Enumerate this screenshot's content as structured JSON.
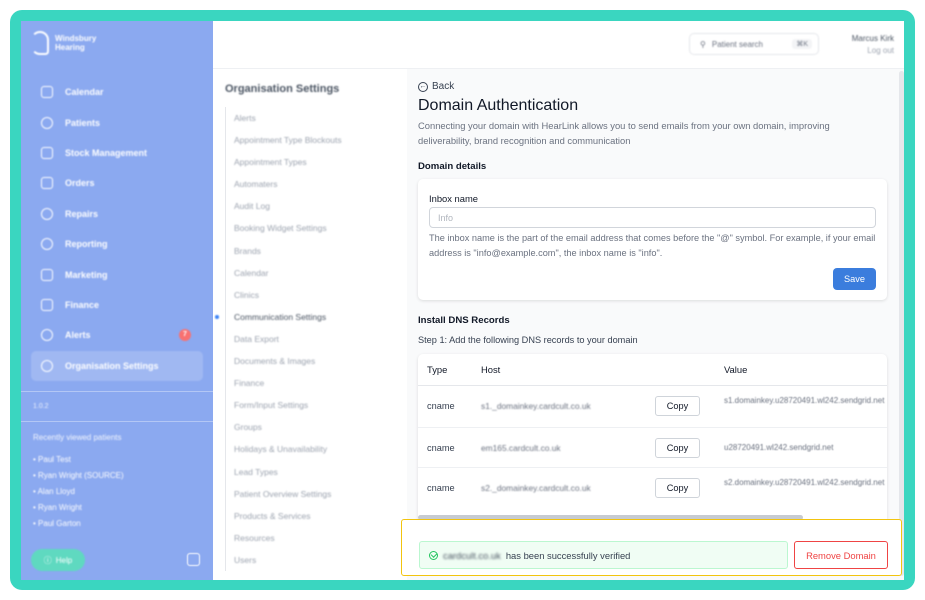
{
  "brand": {
    "line1": "Windsbury",
    "line2": "Hearing"
  },
  "nav": [
    {
      "label": "Calendar",
      "icon": "calendar-icon"
    },
    {
      "label": "Patients",
      "icon": "patients-icon"
    },
    {
      "label": "Stock Management",
      "icon": "stock-icon"
    },
    {
      "label": "Orders",
      "icon": "orders-icon"
    },
    {
      "label": "Repairs",
      "icon": "wrench-icon"
    },
    {
      "label": "Reporting",
      "icon": "chart-icon"
    },
    {
      "label": "Marketing",
      "icon": "mail-icon"
    },
    {
      "label": "Finance",
      "icon": "card-icon"
    },
    {
      "label": "Alerts",
      "icon": "bell-icon",
      "badge": "7"
    },
    {
      "label": "Organisation Settings",
      "icon": "gear-icon",
      "active": true
    }
  ],
  "version": "1.0.2",
  "recent": {
    "title": "Recently viewed patients",
    "items": [
      "Paul Test",
      "Ryan Wright (SOURCE)",
      "Alan Lloyd",
      "Ryan Wright",
      "Paul Garton"
    ]
  },
  "help_label": "Help",
  "header": {
    "search_label": "Patient search",
    "search_shortcut": "⌘K",
    "user_name": "Marcus Kirk",
    "logout": "Log out"
  },
  "settings_menu": {
    "title": "Organisation Settings",
    "items": [
      "Alerts",
      "Appointment Type Blockouts",
      "Appointment Types",
      "Automaters",
      "Audit Log",
      "Booking Widget Settings",
      "Brands",
      "Calendar",
      "Clinics",
      "Communication Settings",
      "Data Export",
      "Documents & Images",
      "Finance",
      "Form/Input Settings",
      "Groups",
      "Holidays & Unavailability",
      "Lead Types",
      "Patient Overview Settings",
      "Products & Services",
      "Resources",
      "Users"
    ],
    "active_index": 9
  },
  "page": {
    "back": "Back",
    "title": "Domain Authentication",
    "description": "Connecting your domain with HearLink allows you to send emails from your own domain, improving deliverability, brand recognition and communication",
    "domain_details_title": "Domain details",
    "inbox_label": "Inbox name",
    "inbox_placeholder": "Info",
    "inbox_help": "The inbox name is the part of the email address that comes before the \"@\" symbol. For example, if your email address is \"info@example.com\", the inbox name is \"info\".",
    "save": "Save",
    "dns_title": "Install DNS Records",
    "dns_step": "Step 1: Add the following DNS records to your domain",
    "dns_columns": [
      "Type",
      "Host",
      "Value"
    ],
    "dns_rows": [
      {
        "type": "cname",
        "host": "s1._domainkey.cardcult.co.uk",
        "copy": "Copy",
        "value": "s1.domainkey.u28720491.wl242.sendgrid.net"
      },
      {
        "type": "cname",
        "host": "em165.cardcult.co.uk",
        "copy": "Copy",
        "value": "u28720491.wl242.sendgrid.net"
      },
      {
        "type": "cname",
        "host": "s2._domainkey.cardcult.co.uk",
        "copy": "Copy",
        "value": "s2.domainkey.u28720491.wl242.sendgrid.net"
      }
    ],
    "verified_domain": "cardcult.co.uk",
    "verified_text": "has been successfully verified",
    "remove_domain": "Remove Domain"
  }
}
